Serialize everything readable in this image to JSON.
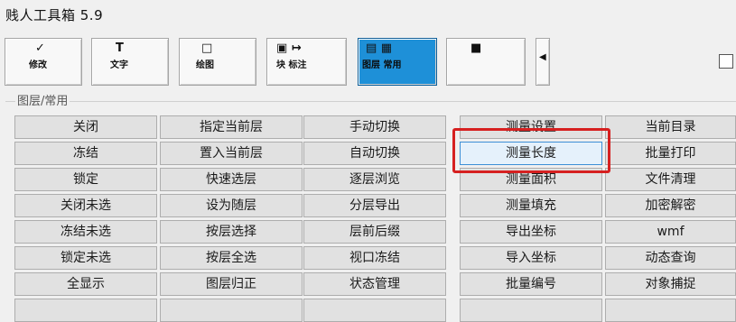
{
  "window": {
    "title": "贱人工具箱 5.9"
  },
  "toolbar": {
    "buttons": [
      {
        "glyph": "✓",
        "label": "修改"
      },
      {
        "glyph": "T",
        "label": "文字"
      },
      {
        "glyph": "□",
        "label": "绘图"
      },
      {
        "glyph": "▣  ↦",
        "label": "块    标注"
      },
      {
        "glyph": "▤  ▦",
        "label": "图层  常用"
      },
      {
        "glyph": "■",
        "label": ""
      },
      {
        "glyph": "◀",
        "label": ""
      }
    ]
  },
  "group": {
    "label": "图层/常用"
  },
  "grid": {
    "rows": [
      [
        "关闭",
        "指定当前层",
        "手动切换",
        "测量设置",
        "当前目录"
      ],
      [
        "冻结",
        "置入当前层",
        "自动切换",
        "测量长度",
        "批量打印"
      ],
      [
        "锁定",
        "快速选层",
        "逐层浏览",
        "测量面积",
        "文件清理"
      ],
      [
        "关闭未选",
        "设为随层",
        "分层导出",
        "测量填充",
        "加密解密"
      ],
      [
        "冻结未选",
        "按层选择",
        "层前后缀",
        "导出坐标",
        "wmf"
      ],
      [
        "锁定未选",
        "按层全选",
        "视口冻结",
        "导入坐标",
        "动态查询"
      ],
      [
        "全显示",
        "图层归正",
        "状态管理",
        "批量编号",
        "对象捕捉"
      ]
    ]
  },
  "colors": {
    "active_tab": "#1e90d8",
    "highlight_border": "#d62020",
    "selected_cell": "#e5f1fb"
  }
}
